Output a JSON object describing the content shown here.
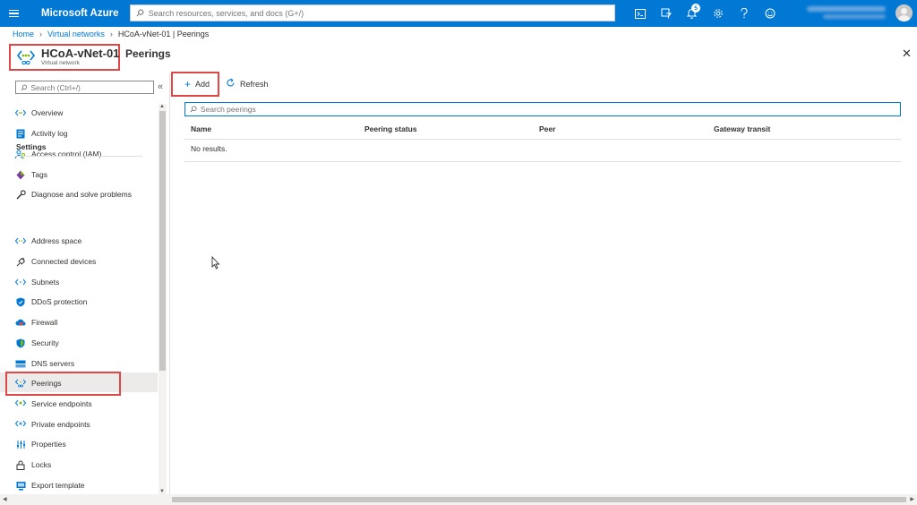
{
  "app": {
    "title": "Microsoft Azure",
    "search_placeholder": "Search resources, services, and docs (G+/)",
    "notification_count": "5",
    "accent": "#0078d4"
  },
  "top_icons": [
    "cloud-shell-icon",
    "directory-filter-icon",
    "bell-icon",
    "gear-icon",
    "help-icon",
    "feedback-icon"
  ],
  "breadcrumb": {
    "items": [
      "Home",
      "Virtual networks"
    ],
    "current": "HCoA-vNet-01 | Peerings"
  },
  "resource": {
    "name": "HCoA-vNet-01",
    "type": "Virtual network"
  },
  "page": {
    "title": "Peerings"
  },
  "sidebar": {
    "search_placeholder": "Search (Ctrl+/)",
    "collapse_glyph": "«",
    "items": [
      {
        "label": "Overview",
        "icon": "overview-icon"
      },
      {
        "label": "Activity log",
        "icon": "activity-log-icon"
      },
      {
        "label": "Access control (IAM)",
        "icon": "iam-icon"
      },
      {
        "label": "Tags",
        "icon": "tag-icon"
      },
      {
        "label": "Diagnose and solve problems",
        "icon": "wrench-icon"
      }
    ],
    "settings_label": "Settings",
    "settings_items": [
      {
        "label": "Address space",
        "icon": "address-space-icon"
      },
      {
        "label": "Connected devices",
        "icon": "plug-icon"
      },
      {
        "label": "Subnets",
        "icon": "subnet-icon"
      },
      {
        "label": "DDoS protection",
        "icon": "shield-icon"
      },
      {
        "label": "Firewall",
        "icon": "firewall-icon"
      },
      {
        "label": "Security",
        "icon": "security-shield-icon"
      },
      {
        "label": "DNS servers",
        "icon": "dns-icon"
      },
      {
        "label": "Peerings",
        "icon": "peering-icon",
        "active": true
      },
      {
        "label": "Service endpoints",
        "icon": "service-endpoint-icon"
      },
      {
        "label": "Private endpoints",
        "icon": "private-endpoint-icon"
      },
      {
        "label": "Properties",
        "icon": "properties-icon"
      },
      {
        "label": "Locks",
        "icon": "lock-icon"
      },
      {
        "label": "Export template",
        "icon": "export-template-icon"
      }
    ]
  },
  "toolbar": {
    "add_label": "Add",
    "refresh_label": "Refresh"
  },
  "content": {
    "search_placeholder": "Search peerings",
    "columns": [
      "Name",
      "Peering status",
      "Peer",
      "Gateway transit"
    ],
    "empty_text": "No results."
  }
}
